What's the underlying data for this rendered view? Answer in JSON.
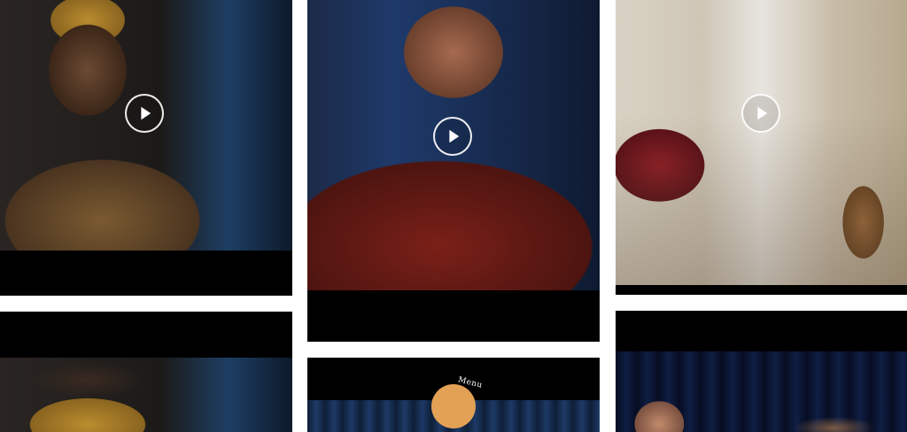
{
  "gallery": {
    "items": [
      {
        "id": "tile-1",
        "play_label": ""
      },
      {
        "id": "tile-2",
        "play_label": ""
      },
      {
        "id": "tile-3",
        "play_label": ""
      }
    ]
  },
  "menu": {
    "label": "Menu",
    "color": "#e2a155"
  }
}
